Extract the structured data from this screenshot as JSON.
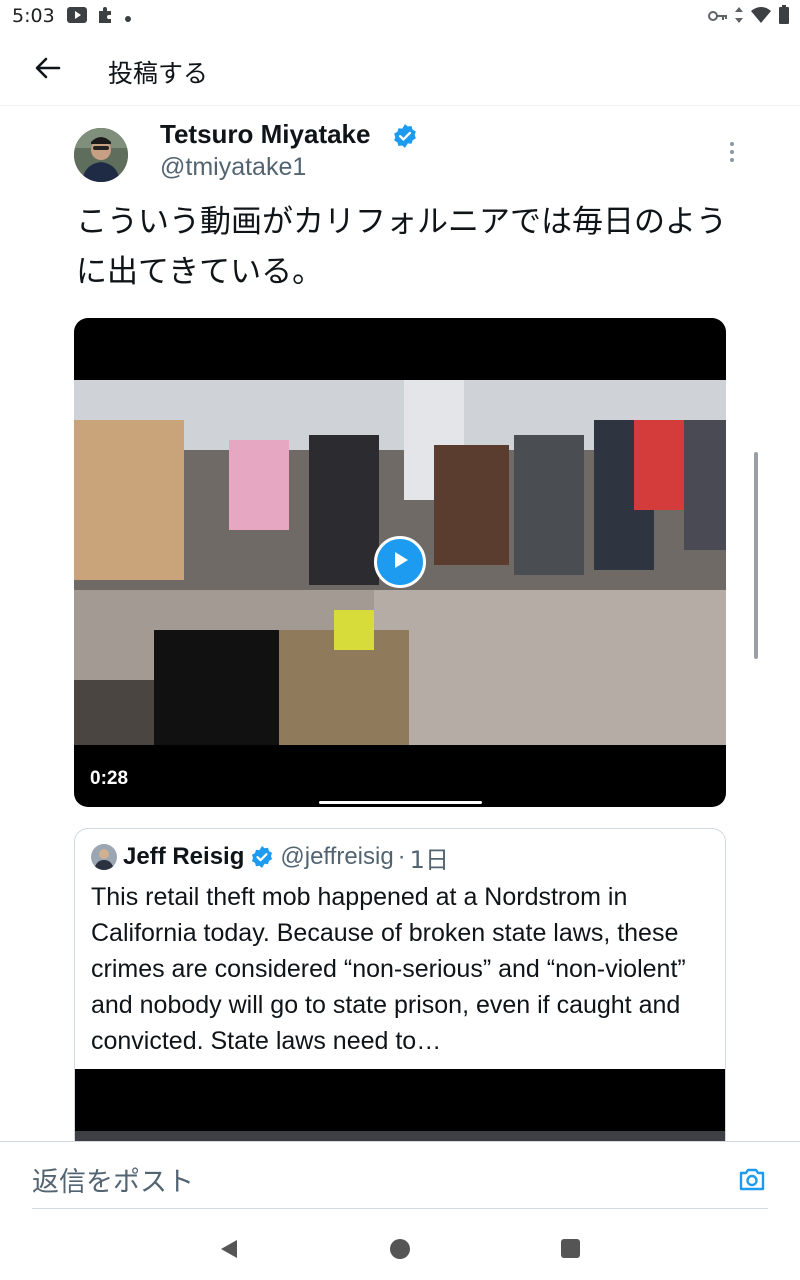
{
  "status_bar": {
    "time": "5:03",
    "left_icons": [
      "youtube-icon",
      "puzzle-icon",
      "dot-icon"
    ],
    "right_icons": [
      "key-icon",
      "data-arrows-icon",
      "wifi-icon",
      "battery-icon"
    ]
  },
  "header": {
    "back_icon": "arrow-left-icon",
    "title": "投稿する"
  },
  "tweet": {
    "author_name": "Tetsuro Miyatake",
    "author_handle": "@tmiyatake1",
    "verified": true,
    "text": "こういう動画がカリフォルニアでは毎日のように出てきている。",
    "video": {
      "duration": "0:28",
      "progress": 0.25
    }
  },
  "quote": {
    "author_name": "Jeff Reisig",
    "author_handle": "@jeffreisig",
    "separator": "·",
    "time": "1日",
    "verified": true,
    "text": "This retail theft mob happened at a Nordstrom in California today. Because of broken state laws, these crimes are considered “non-serious” and “non-violent” and nobody will go to state prison, even if caught and convicted. State laws need to…"
  },
  "reply": {
    "placeholder": "返信をポスト",
    "camera_icon": "camera-icon"
  },
  "nav": {
    "icons": [
      "nav-back-icon",
      "nav-home-icon",
      "nav-recents-icon"
    ]
  },
  "colors": {
    "accent": "#1d9bf0",
    "text_primary": "#0f1419",
    "text_secondary": "#536471",
    "border": "#cfd9de"
  }
}
